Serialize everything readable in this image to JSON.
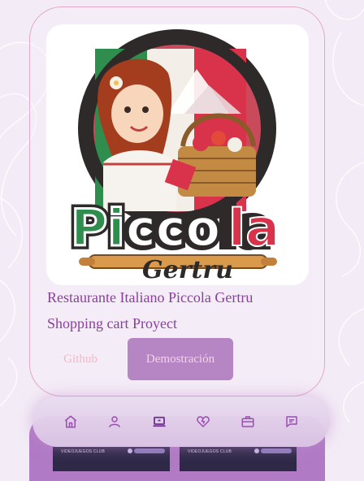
{
  "colors": {
    "background": "#f3ecf6",
    "accent_purple": "#8a3f9e",
    "button_purple": "#b585c4",
    "card_border": "#e2a9c8",
    "github_pink": "#f5b7c7",
    "nav_icon": "#9a4fb0",
    "nav_icon_active": "#6f2f8e"
  },
  "project": {
    "logo_alt": "Piccola Gertru logo",
    "logo_lettering": "Piccola Gertru",
    "title": "Restaurante Italiano Piccola Gertru",
    "subtitle": "Shopping cart Proyect",
    "github_label": "Github",
    "demo_label": "Demostración"
  },
  "next_card": {
    "thumb_1_text": "VIDEOJUEGOS CLUB",
    "thumb_2_text": "VIDEOJUEGOS CLUB"
  },
  "nav": {
    "items": [
      {
        "icon": "home-icon",
        "active": false
      },
      {
        "icon": "user-icon",
        "active": false
      },
      {
        "icon": "laptop-icon",
        "active": true
      },
      {
        "icon": "heart-icon",
        "active": false
      },
      {
        "icon": "briefcase-icon",
        "active": false
      },
      {
        "icon": "message-icon",
        "active": false
      }
    ]
  }
}
